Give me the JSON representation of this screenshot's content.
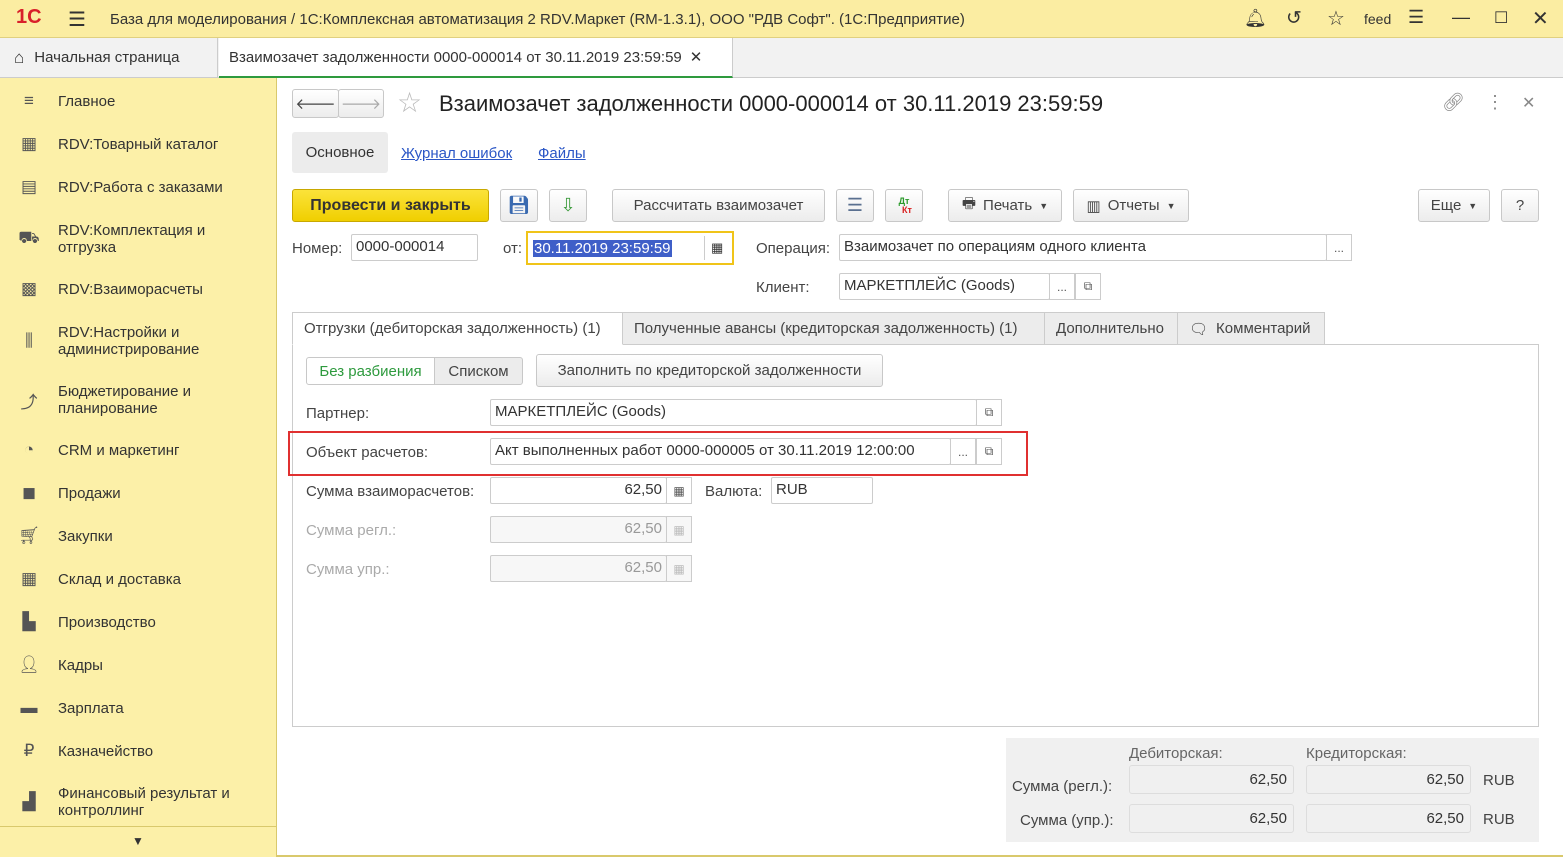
{
  "titlebar": {
    "logo": "1С",
    "title": "База для моделирования / 1С:Комплексная автоматизация 2 RDV.Маркет (RM-1.3.1), ООО \"РДВ Софт\".  (1С:Предприятие)",
    "user": "feed"
  },
  "tabs": {
    "home": "Начальная страница",
    "doc": "Взаимозачет задолженности 0000-000014 от 30.11.2019 23:59:59"
  },
  "sidebar": {
    "items": [
      {
        "label": "Главное",
        "icon": "menu-icon"
      },
      {
        "label": "RDV:Товарный каталог",
        "icon": "catalog-icon"
      },
      {
        "label": "RDV:Работа с заказами",
        "icon": "orders-icon"
      },
      {
        "label": "RDV:Комплектация и отгрузка",
        "icon": "shipping-icon"
      },
      {
        "label": "RDV:Взаиморасчеты",
        "icon": "calculator-icon"
      },
      {
        "label": "RDV:Настройки и администрирование",
        "icon": "settings-icon"
      },
      {
        "label": "Бюджетирование и планирование",
        "icon": "budget-icon"
      },
      {
        "label": "CRM и маркетинг",
        "icon": "pie-icon"
      },
      {
        "label": "Продажи",
        "icon": "bag-icon"
      },
      {
        "label": "Закупки",
        "icon": "cart-icon"
      },
      {
        "label": "Склад и доставка",
        "icon": "warehouse-icon"
      },
      {
        "label": "Производство",
        "icon": "factory-icon"
      },
      {
        "label": "Кадры",
        "icon": "person-icon"
      },
      {
        "label": "Зарплата",
        "icon": "card-icon"
      },
      {
        "label": "Казначейство",
        "icon": "ruble-icon"
      },
      {
        "label": "Финансовый результат и контроллинг",
        "icon": "chart-icon"
      }
    ]
  },
  "doc": {
    "title": "Взаимозачет задолженности 0000-000014 от 30.11.2019 23:59:59",
    "subtabs": [
      "Основное",
      "Журнал ошибок",
      "Файлы"
    ],
    "toolbar": {
      "post_close": "Провести и закрыть",
      "calc": "Рассчитать взаимозачет",
      "dtkt_dt": "Дт",
      "dtkt_kt": "Кт",
      "print": "Печать",
      "reports": "Отчеты",
      "more": "Еще",
      "help": "?"
    },
    "number_label": "Номер:",
    "number": "0000-000014",
    "date_label": "от:",
    "date": "30.11.2019 23:59:59",
    "operation_label": "Операция:",
    "operation": "Взаимозачет по операциям одного клиента",
    "client_label": "Клиент:",
    "client": "МАРКЕТПЛЕЙС (Goods)",
    "pages": [
      "Отгрузки (дебиторская задолженность) (1)",
      "Полученные авансы (кредиторская задолженность) (1)",
      "Дополнительно",
      "Комментарий"
    ],
    "mode": [
      "Без разбиения",
      "Списком"
    ],
    "fill": "Заполнить по кредиторской задолженности",
    "partner_label": "Партнер:",
    "partner": "МАРКЕТПЛЕЙС (Goods)",
    "object_label": "Объект расчетов:",
    "object": "Акт выполненных работ 0000-000005 от 30.11.2019 12:00:00",
    "sum_label": "Сумма взаиморасчетов:",
    "sum": "62,50",
    "currency_label": "Валюта:",
    "currency": "RUB",
    "sum_reg_label": "Сумма регл.:",
    "sum_reg": "62,50",
    "sum_upr_label": "Сумма упр.:",
    "sum_upr": "62,50",
    "totals": {
      "deb": "Дебиторская:",
      "cred": "Кредиторская:",
      "reg_label": "Сумма (регл.):",
      "upr_label": "Сумма (упр.):",
      "reg_deb": "62,50",
      "reg_cred": "62,50",
      "upr_deb": "62,50",
      "upr_cred": "62,50",
      "cur1": "RUB",
      "cur2": "RUB"
    }
  },
  "colors": {
    "accent": "#f5d400",
    "highlight_box": "#e03030",
    "active_tab": "#2e9a3e"
  }
}
